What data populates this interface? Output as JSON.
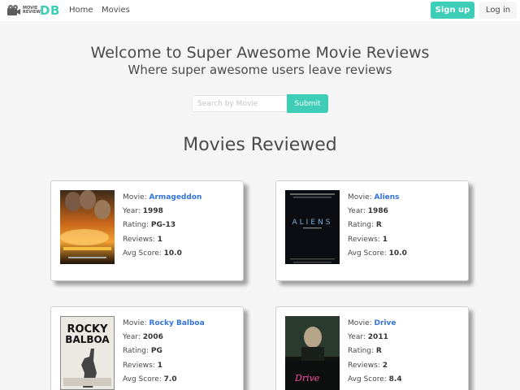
{
  "nav": {
    "brand_small_line1": "MOVIE",
    "brand_small_line2": "REVIEWS",
    "brand_db": "DB",
    "home": "Home",
    "movies": "Movies",
    "signup": "Sign up",
    "login": "Log in"
  },
  "hero": {
    "title": "Welcome to Super Awesome Movie Reviews",
    "subtitle": "Where super awesome users leave reviews"
  },
  "search": {
    "placeholder": "Search by Movie",
    "button": "Submit"
  },
  "section_title": "Movies Reviewed",
  "labels": {
    "movie": "Movie: ",
    "year": "Year: ",
    "rating": "Rating: ",
    "reviews": "Reviews: ",
    "avg": "Avg Score: "
  },
  "movies": [
    {
      "title": "Armageddon",
      "year": "1998",
      "rating": "PG-13",
      "reviews": "1",
      "avg_score": "10.0"
    },
    {
      "title": "Aliens",
      "year": "1986",
      "rating": "R",
      "reviews": "1",
      "avg_score": "10.0",
      "poster_text": "ALIENS"
    },
    {
      "title": "Rocky Balboa",
      "year": "2006",
      "rating": "PG",
      "reviews": "1",
      "avg_score": "7.0",
      "poster_text_1": "ROCKY",
      "poster_text_2": "BALBOA"
    },
    {
      "title": "Drive",
      "year": "2011",
      "rating": "R",
      "reviews": "2",
      "avg_score": "8.4",
      "poster_text": "Drive"
    }
  ],
  "colors": {
    "accent": "#3ecdb7",
    "link": "#3273dc"
  }
}
